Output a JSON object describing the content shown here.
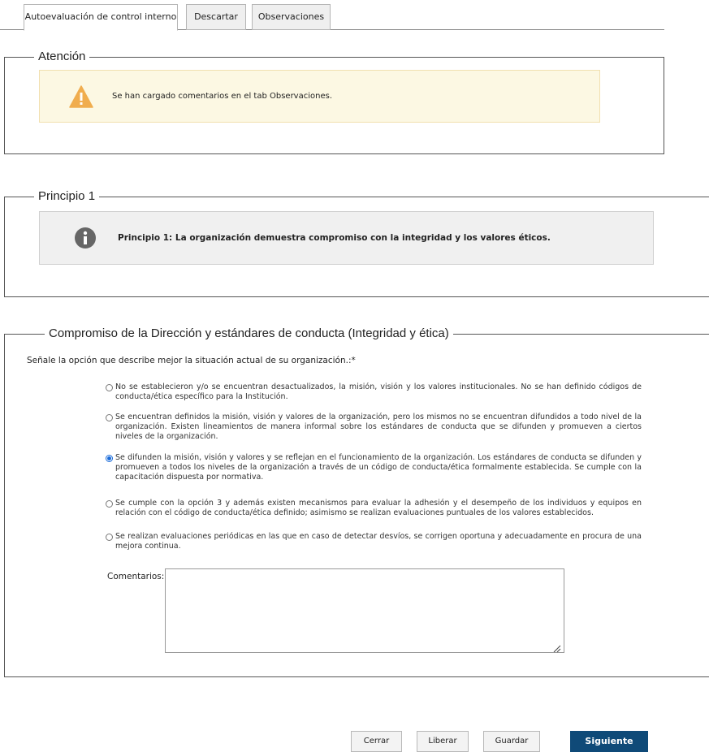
{
  "tabs": [
    {
      "label": "Autoevaluación de control interno"
    },
    {
      "label": "Descartar"
    },
    {
      "label": "Observaciones"
    }
  ],
  "attention": {
    "legend": "Atención",
    "message": "Se han cargado comentarios en el tab Observaciones.",
    "icon": "warning-icon",
    "color": "#f0ad4e"
  },
  "principle": {
    "legend": "Principio 1",
    "message": "Principio 1: La organización demuestra compromiso con la integridad y los valores éticos.",
    "icon": "info-icon",
    "color": "#666666"
  },
  "commitment": {
    "legend": "Compromiso de la Dirección y estándares de conducta (Integridad y ética)",
    "question": "Señale la opción que describe mejor la situación actual de su organización.:*",
    "options": [
      {
        "text": "No se establecieron y/o se encuentran desactualizados, la misión, visión y los valores institucionales. No se han definido códigos de conducta/ética específico para la Institución.",
        "selected": false
      },
      {
        "text": "Se encuentran definidos la misión, visión y valores de la organización, pero los mismos no se encuentran difundidos a todo nivel de la organización. Existen lineamientos de manera informal sobre los estándares de conducta que se difunden y promueven a ciertos niveles de la organización.",
        "selected": false
      },
      {
        "text": "Se difunden la misión, visión y valores y se reflejan en el funcionamiento de la organización. Los estándares de conducta se difunden y promueven a todos los niveles de la organización a través de un código de conducta/ética formalmente establecida. Se cumple con la capacitación dispuesta por normativa.",
        "selected": true
      },
      {
        "text": "Se cumple con la opción 3 y además existen mecanismos para evaluar la adhesión y el desempeño de los individuos y equipos en relación con el código de conducta/ética definido; asimismo se realizan evaluaciones puntuales de los valores establecidos.",
        "selected": false
      },
      {
        "text": "Se realizan evaluaciones periódicas en las que en caso de detectar desvíos, se corrigen oportuna y adecuadamente en procura de una mejora continua.",
        "selected": false
      }
    ],
    "comments_label": "Comentarios:",
    "comments_value": ""
  },
  "buttons": {
    "close": "Cerrar",
    "release": "Liberar",
    "save": "Guardar",
    "next": "Siguiente",
    "accent": "#0f4a78"
  }
}
